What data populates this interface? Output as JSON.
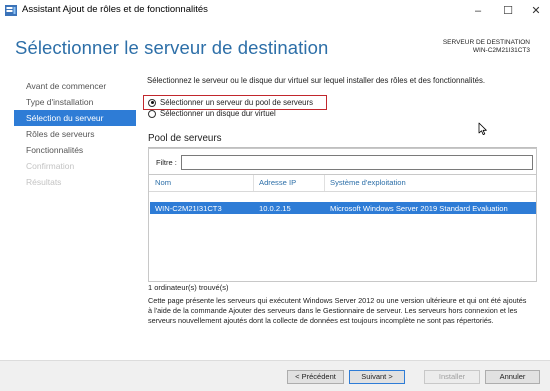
{
  "window": {
    "title": "Assistant Ajout de rôles et de fonctionnalités",
    "icon": "server-manager-icon",
    "controls": {
      "minimize": "–",
      "maximize": "☐",
      "close": "✕"
    }
  },
  "header": {
    "title": "Sélectionner le serveur de destination",
    "destination_label": "SERVEUR DE DESTINATION",
    "destination_server": "WIN-C2M21I31CT3"
  },
  "nav": {
    "items": [
      {
        "label": "Avant de commencer",
        "state": "normal"
      },
      {
        "label": "Type d'installation",
        "state": "normal"
      },
      {
        "label": "Sélection du serveur",
        "state": "active"
      },
      {
        "label": "Rôles de serveurs",
        "state": "normal"
      },
      {
        "label": "Fonctionnalités",
        "state": "normal"
      },
      {
        "label": "Confirmation",
        "state": "disabled"
      },
      {
        "label": "Résultats",
        "state": "disabled"
      }
    ]
  },
  "main": {
    "instruction": "Sélectionnez le serveur ou le disque dur virtuel sur lequel installer des rôles et des fonctionnalités.",
    "options": [
      {
        "label": "Sélectionner un serveur du pool de serveurs",
        "checked": true
      },
      {
        "label": "Sélectionner un disque dur virtuel",
        "checked": false
      }
    ],
    "pool": {
      "title": "Pool de serveurs",
      "filter_label": "Filtre :",
      "filter_value": "",
      "columns": [
        "Nom",
        "Adresse IP",
        "Système d'exploitation"
      ],
      "rows": [
        [
          "WIN-C2M21I31CT3",
          "10.0.2.15",
          "Microsoft Windows Server 2019 Standard Evaluation"
        ]
      ],
      "count_text": "1 ordinateur(s) trouvé(s)"
    },
    "description": "Cette page présente les serveurs qui exécutent Windows Server 2012 ou une version ultérieure et qui ont été ajoutés à l'aide de la commande Ajouter des serveurs dans le Gestionnaire de serveur. Les serveurs hors connexion et les serveurs nouvellement ajoutés dont la collecte de données est toujours incomplète ne sont pas répertoriés."
  },
  "footer": {
    "previous": "< Précédent",
    "next": "Suivant >",
    "install": "Installer",
    "cancel": "Annuler"
  },
  "colors": {
    "accent": "#2e7cd6",
    "heading": "#2d6fa8",
    "highlight_box": "#c1272d"
  }
}
